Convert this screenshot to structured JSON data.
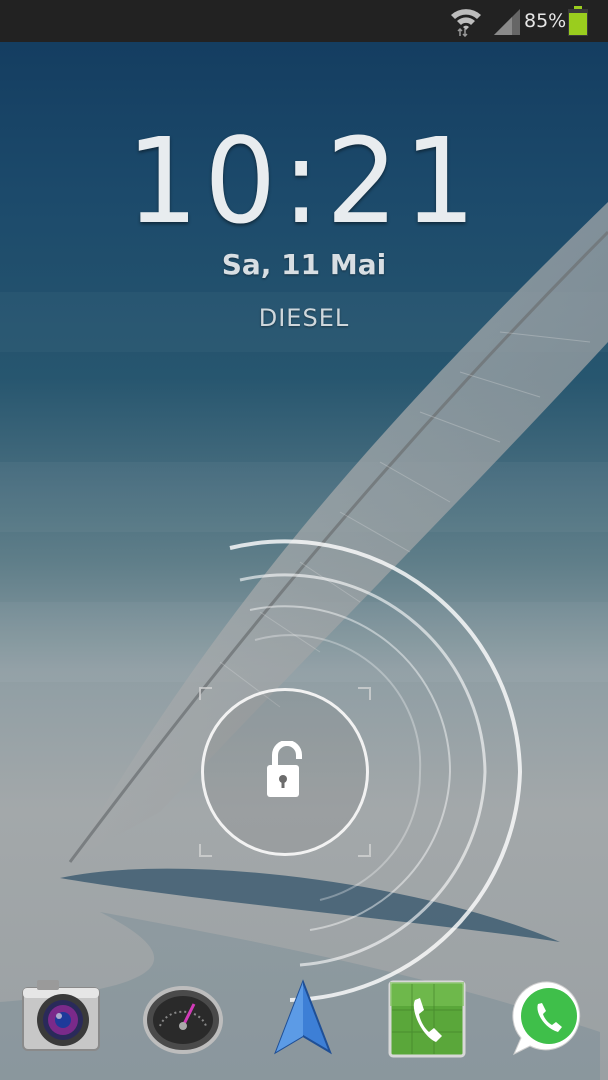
{
  "status_bar": {
    "battery_percent": "85%",
    "battery_level": 0.85,
    "icons": [
      "wifi-icon",
      "cell-signal-icon",
      "battery-icon"
    ]
  },
  "lockscreen": {
    "time": "10:21",
    "date": "Sa, 11 Mai",
    "owner_text": "DIESEL"
  },
  "unlock": {
    "icon": "unlock-padlock-icon"
  },
  "dock": {
    "items": [
      {
        "icon": "camera-icon"
      },
      {
        "icon": "speedometer-icon"
      },
      {
        "icon": "navigation-arrow-icon"
      },
      {
        "icon": "phone-icon"
      },
      {
        "icon": "whatsapp-icon"
      }
    ]
  },
  "colors": {
    "status_bar": "#222222",
    "battery": "#9acd1e",
    "text": "#e8ecef"
  }
}
